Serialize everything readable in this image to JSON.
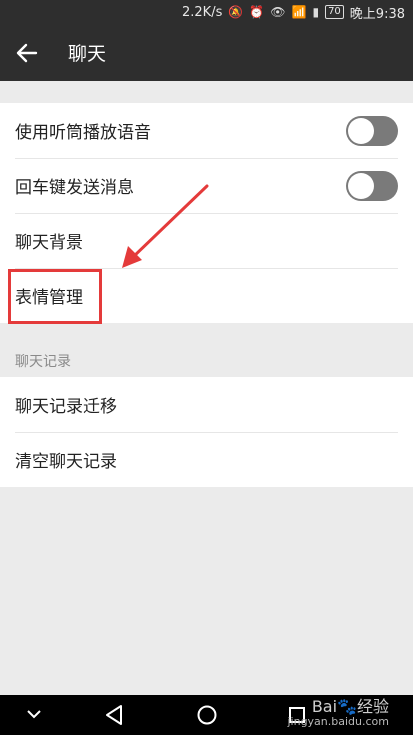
{
  "status_bar": {
    "net_speed": "2.2K/s",
    "battery": "70",
    "time": "晚上9:38"
  },
  "header": {
    "title": "聊天"
  },
  "settings": {
    "items": [
      {
        "label": "使用听筒播放语音",
        "toggle": false
      },
      {
        "label": "回车键发送消息",
        "toggle": false
      },
      {
        "label": "聊天背景"
      },
      {
        "label": "表情管理",
        "highlighted": true
      }
    ],
    "section_header": "聊天记录",
    "records": [
      {
        "label": "聊天记录迁移"
      },
      {
        "label": "清空聊天记录"
      }
    ]
  },
  "watermark": {
    "brand_left": "Bai",
    "brand_right": "经验",
    "url": "jingyan.baidu.com"
  },
  "colors": {
    "bar": "#2e2e2e",
    "page_bg": "#ebebeb",
    "toggle_off": "#7a7a7a",
    "annotation_red": "#e43a3a"
  }
}
